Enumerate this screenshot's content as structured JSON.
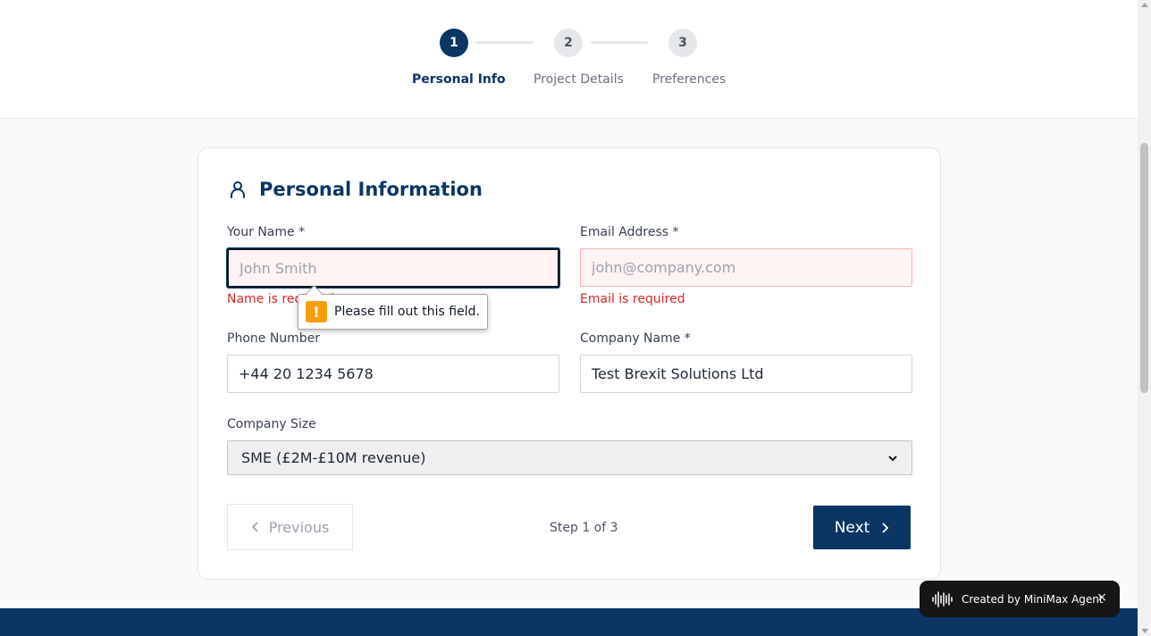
{
  "stepper": {
    "steps": [
      {
        "number": "1",
        "label": "Personal Info",
        "state": "active"
      },
      {
        "number": "2",
        "label": "Project Details",
        "state": "inactive"
      },
      {
        "number": "3",
        "label": "Preferences",
        "state": "inactive"
      }
    ]
  },
  "form": {
    "section_icon": "user-icon",
    "title": "Personal Information",
    "fields": {
      "name": {
        "label": "Your Name *",
        "placeholder": "John Smith",
        "value": "",
        "error": "Name is required"
      },
      "email": {
        "label": "Email Address *",
        "placeholder": "john@company.com",
        "value": "",
        "error": "Email is required"
      },
      "phone": {
        "label": "Phone Number",
        "placeholder": "",
        "value": "+44 20 1234 5678"
      },
      "company": {
        "label": "Company Name *",
        "placeholder": "",
        "value": "Test Brexit Solutions Ltd"
      },
      "company_size": {
        "label": "Company Size",
        "selected": "SME (£2M-£10M revenue)"
      }
    },
    "tooltip": {
      "icon": "warning-icon",
      "text": "Please fill out this field."
    },
    "nav": {
      "previous_label": "Previous",
      "step_count": "Step 1 of 3",
      "next_label": "Next"
    }
  },
  "agent_badge": {
    "icon": "waveform-icon",
    "text": "Created by MiniMax Agent",
    "close": "×"
  },
  "colors": {
    "brand": "#0b3563",
    "error": "#dc2626",
    "error_bg": "#fef2f2",
    "warning": "#f59e0b"
  }
}
